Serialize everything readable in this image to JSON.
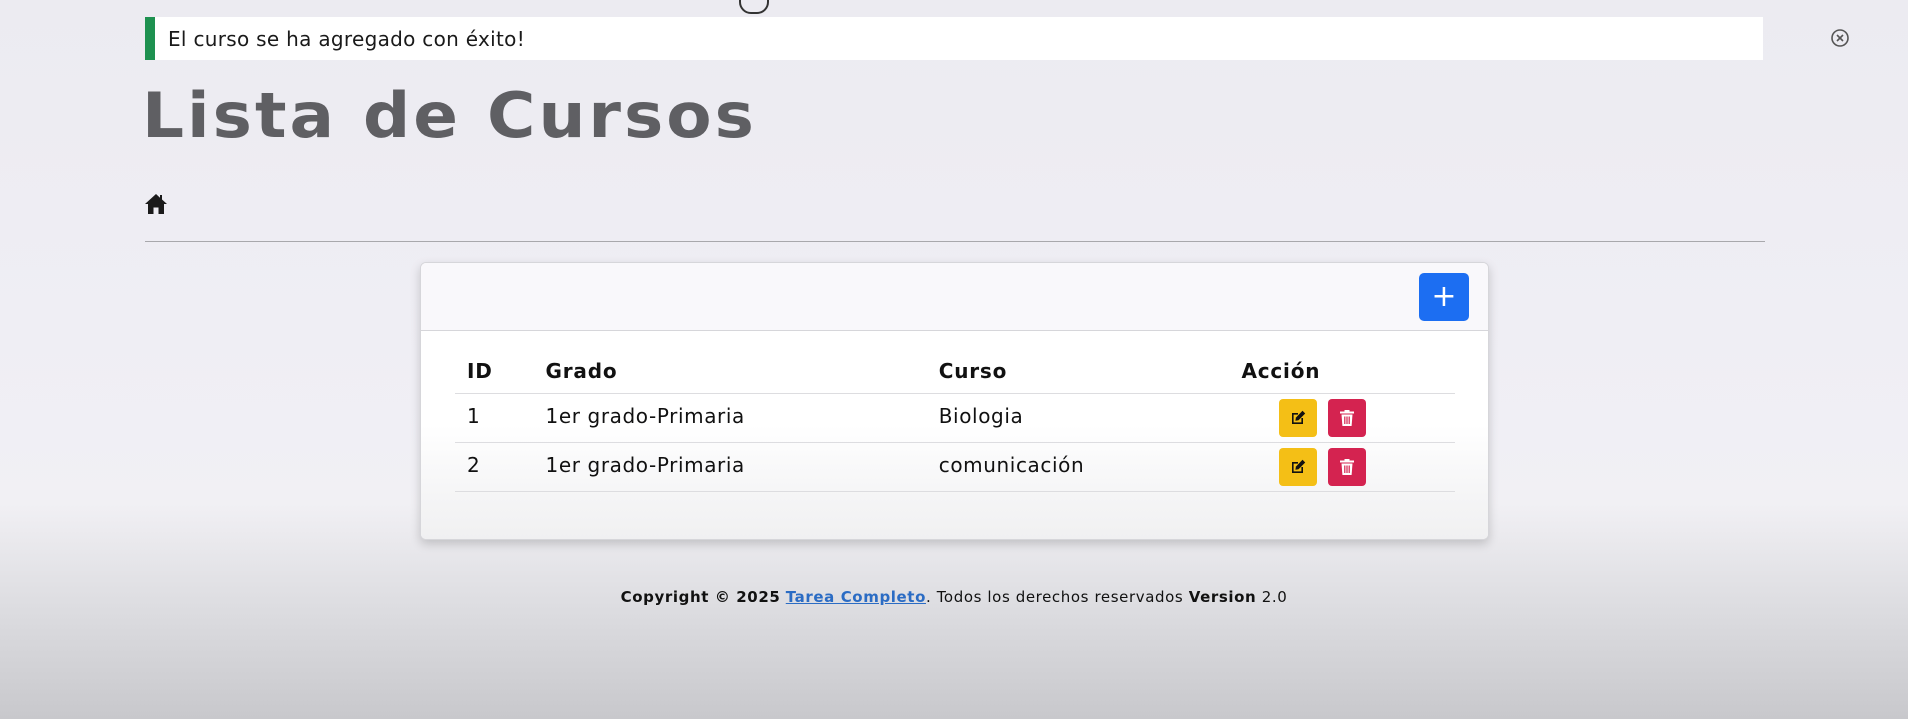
{
  "alert": {
    "message": "El curso se ha agregado con éxito!",
    "accent_color": "#1e9150",
    "close_icon": "circle-x-icon"
  },
  "header": {
    "title": "Lista de Cursos",
    "home_icon": "home-icon"
  },
  "card": {
    "add_button_label": "+",
    "add_button_color": "#1c6ef2",
    "table": {
      "columns": [
        "ID",
        "Grado",
        "Curso",
        "Acción"
      ],
      "rows": [
        {
          "id": "1",
          "grado": "1er grado-Primaria",
          "curso": "Biologia"
        },
        {
          "id": "2",
          "grado": "1er grado-Primaria",
          "curso": "comunicación"
        }
      ],
      "edit_icon": "edit-icon",
      "edit_color": "#f4bf16",
      "delete_icon": "trash-icon",
      "delete_color": "#d42350"
    }
  },
  "footer": {
    "copyright": "Copyright © 2025",
    "link_text": "Tarea Completo",
    "rights": ". Todos los derechos reservados",
    "version_label": "Version",
    "version_value": "2.0"
  }
}
